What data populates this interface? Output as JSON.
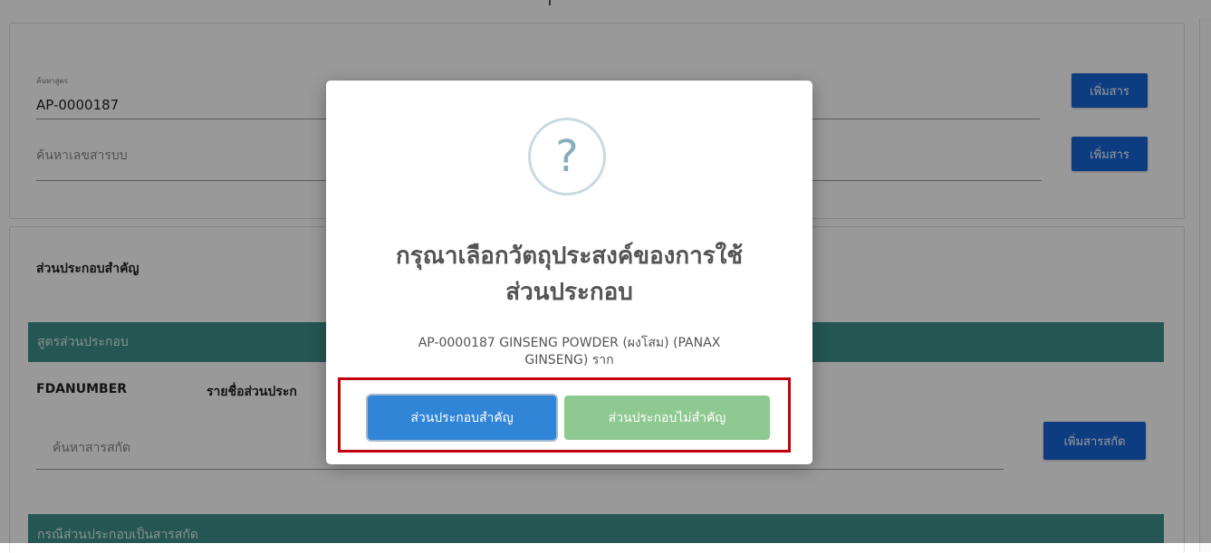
{
  "search_formula": {
    "label": "ค้นหาสูตร",
    "value": "AP-0000187",
    "add_button": "เพิ่มสาร"
  },
  "search_substance": {
    "placeholder": "ค้นหาเลขสารบบ",
    "add_button": "เพิ่มสาร"
  },
  "main_section": {
    "title": "ส่วนประกอบสำคัญ",
    "formula_bar": "สูตรส่วนประกอบ",
    "columns": [
      "FDANUMBER",
      "รายชื่อส่วนประก"
    ],
    "extract_search_placeholder": "ค้นหาสารสกัด",
    "add_extract_button": "เพิ่มสารสกัด",
    "extract_bar": "กรณีส่วนประกอบเป็นสารสกัด"
  },
  "dialog": {
    "icon": "question-icon",
    "title_line1": "กรุณาเลือกวัตถุประสงค์ของการใช้",
    "title_line2": "ส่วนประกอบ",
    "text_line1": "AP-0000187 GINSENG POWDER (ผงโสม) (PANAX",
    "text_line2": "GINSENG) ราก",
    "confirm_button": "ส่วนประกอบสำคัญ",
    "cancel_button": "ส่วนประกอบไม่สำคัญ"
  },
  "colors": {
    "primary_button": "#1766d6",
    "teal_header": "#3e8f8a",
    "dialog_confirm": "#3085d6",
    "dialog_cancel": "#8fc992",
    "highlight": "#c0000b"
  }
}
